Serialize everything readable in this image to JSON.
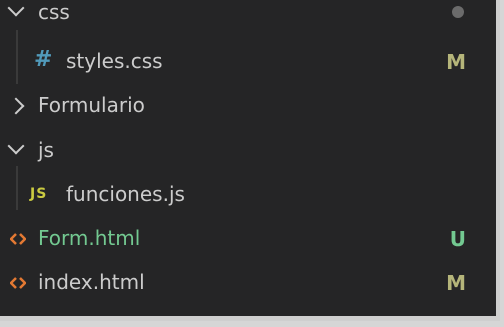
{
  "explorer": {
    "items": [
      {
        "label": "css",
        "type": "folder",
        "expanded": true,
        "indicator": "dot",
        "indicator_color": "#6b6b6b"
      },
      {
        "label": "styles.css",
        "type": "file",
        "icon": "hash-icon",
        "status": "M"
      },
      {
        "label": "Formulario",
        "type": "folder",
        "expanded": false
      },
      {
        "label": "js",
        "type": "folder",
        "expanded": true
      },
      {
        "label": "funciones.js",
        "type": "file",
        "icon": "js-icon",
        "icon_text": "JS"
      },
      {
        "label": "Form.html",
        "type": "file",
        "icon": "html-icon",
        "status": "U",
        "label_color": "#73c991"
      },
      {
        "label": "index.html",
        "type": "file",
        "icon": "html-icon",
        "status": "M"
      }
    ]
  },
  "colors": {
    "background": "#252526",
    "text": "#cccccc",
    "untracked": "#73c991",
    "modified": "#b5b57a",
    "css_icon": "#519aba",
    "js_icon": "#cbcb41",
    "html_icon": "#e37933"
  }
}
